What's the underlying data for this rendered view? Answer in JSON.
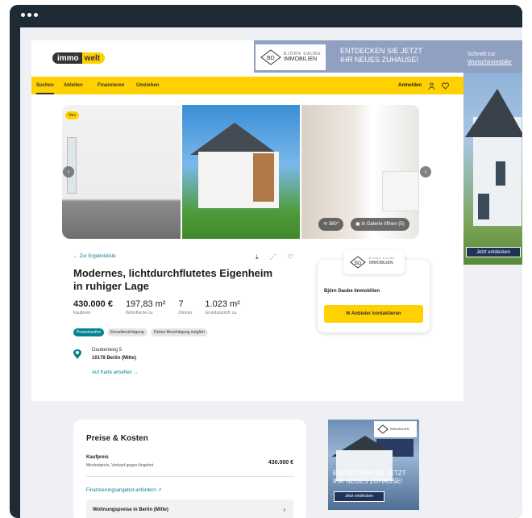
{
  "header": {
    "logo_left": "immo",
    "logo_right": "welt"
  },
  "nav": {
    "items": [
      "Suchen",
      "Ableiten",
      "Finanzieren",
      "Umziehen"
    ],
    "login": "Anmelden"
  },
  "banner": {
    "brand_small": "BJÖRN DAUBE",
    "brand": "IMMOBILIEN",
    "headline_1": "ENTDECKEN SIE JETZT",
    "headline_2": "IHR NEUES ZUHAUSE!",
    "side_1": "Schnell zur",
    "side_2": "Wunschimmobilie",
    "cta": "Jetzt entdecken"
  },
  "gallery": {
    "badge": "Neu",
    "view360": "360°",
    "open_gallery": "In Galerie öffnen (5)"
  },
  "listing": {
    "back": "← Zur Ergebnisliste",
    "title": "Modernes, lichtdurchflutetes Eigenheim in ruhiger Lage",
    "facts": [
      {
        "value": "430.000 €",
        "label": "Kaufpreis"
      },
      {
        "value": "197,83 m²",
        "label": "Wohnfläche ca."
      },
      {
        "value": "7",
        "label": "Zimmer"
      },
      {
        "value": "1.023 m²",
        "label": "Grundstücksfl. ca."
      }
    ],
    "tags": [
      "Provisionsfrei",
      "Einzelbesichtigung",
      "Online-Besichtigung möglich"
    ],
    "street": "Daubenweg 5",
    "city": "10178 Berlin (Mitte)",
    "map_link": "Auf Karte ansehen →"
  },
  "contact": {
    "logo_small": "BJÖRN DAUBE",
    "logo": "IMMOBILIEN",
    "name": "Björn Daube Immobilien",
    "button": "Anbieter kontaktieren"
  },
  "prices": {
    "heading": "Preise & Kosten",
    "label": "Kaufpreis",
    "sublabel": "Mindestpreis, Verkauf gegen Angebot",
    "value": "430.000 €",
    "financing_link": "Finanzierungsangebot anfordern ↗",
    "row": "Wohnungspreise in Berlin (Mitte)",
    "row_chevron": "›"
  },
  "ad2": {
    "logo": "IMMOBILIEN",
    "headline_1": "ENTDECKEN SIE JETZT",
    "headline_2": "IHR NEUES ZUHAUSE!",
    "cta": "Jetzt entdecken"
  },
  "colors": {
    "brand_yellow": "#ffd100",
    "teal": "#00838f",
    "frame": "#1f2b34"
  }
}
